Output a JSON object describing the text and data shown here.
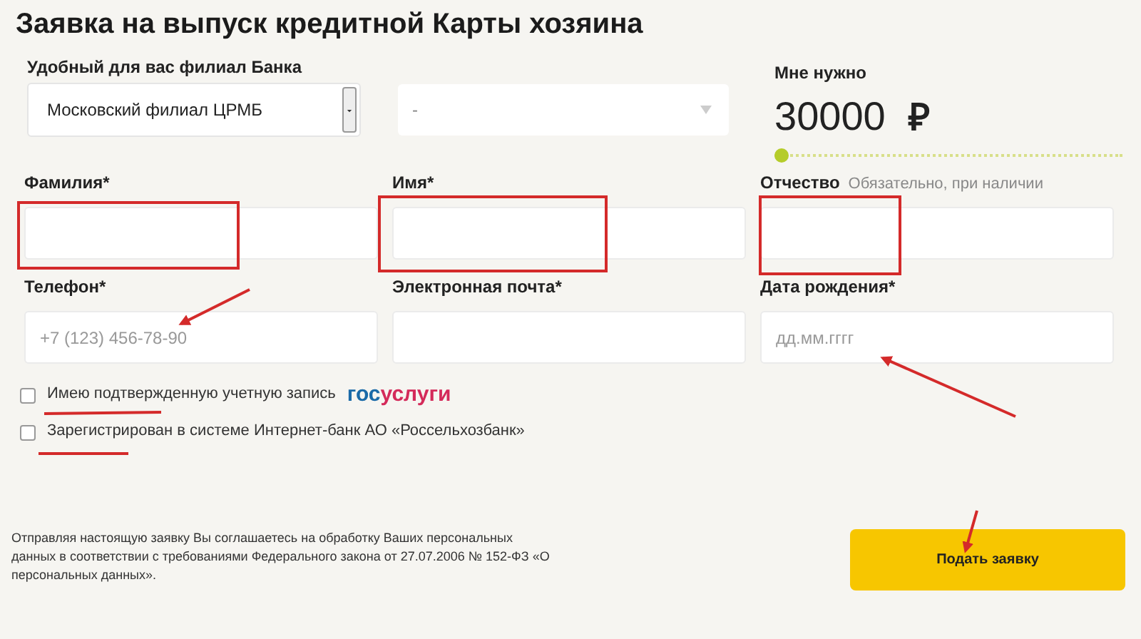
{
  "title": "Заявка на выпуск кредитной Карты хозяина",
  "branch": {
    "label": "Удобный для вас филиал Банка",
    "value": "Московский филиал ЦРМБ"
  },
  "second_select": {
    "value": "-"
  },
  "amount": {
    "label": "Мне нужно",
    "value": "30000",
    "currency": "₽",
    "level": 0
  },
  "fields": [
    {
      "label": "Фамилия*"
    },
    {
      "label": "Имя*"
    },
    {
      "label": "Отчество",
      "hint": "Обязательно, при наличии"
    },
    {
      "label": "Телефон*",
      "placeholder": "+7 (123) 456-78-90"
    },
    {
      "label": "Электронная почта*"
    },
    {
      "label": "Дата рождения*",
      "placeholder": "дд.мм.гггг"
    }
  ],
  "checkboxes": [
    {
      "label": "Имею подтвержденную учетную запись",
      "checked": false,
      "logo": [
        "гос",
        "услуги"
      ]
    },
    {
      "label": "Зарегистрирован в системе Интернет-банк АО «Россельхозбанк»",
      "checked": false
    }
  ],
  "disclaimer": "Отправляя настоящую заявку Вы соглашаетесь на обработку Ваших персональных данных в соответствии с требованиями Федерального закона от 27.07.2006 № 152-ФЗ «О персональных данных».",
  "submit": "Подать заявку"
}
